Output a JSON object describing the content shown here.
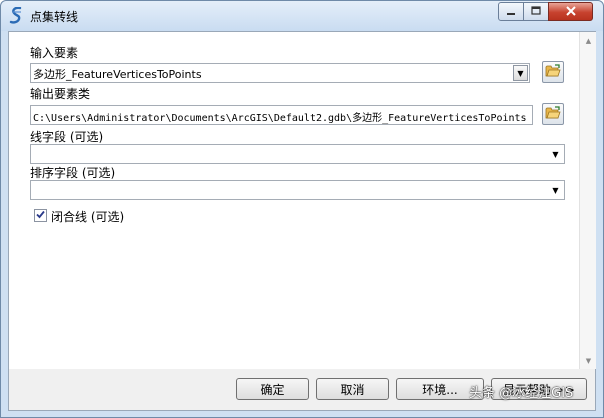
{
  "window": {
    "title": "点集转线"
  },
  "fields": {
    "input_features": {
      "label": "输入要素",
      "value": "多边形_FeatureVerticesToPoints"
    },
    "output_feature_class": {
      "label": "输出要素类",
      "value": "C:\\Users\\Administrator\\Documents\\ArcGIS\\Default2.gdb\\多边形_FeatureVerticesToPoints"
    },
    "line_field": {
      "label": "线字段 (可选)",
      "value": ""
    },
    "sort_field": {
      "label": "排序字段 (可选)",
      "value": ""
    },
    "close_line": {
      "label": "闭合线 (可选)",
      "checked": true
    }
  },
  "buttons": {
    "ok": "确定",
    "cancel": "取消",
    "environments": "环境...",
    "show_help": "显示帮助 >>"
  },
  "watermark": "头条 @冰经注GIS",
  "icons": {
    "app": "tool-icon",
    "browse": "folder-open-icon",
    "minimize": "minimize-icon",
    "maximize": "maximize-icon",
    "close": "close-icon"
  },
  "colors": {
    "titlebar": "#c9dcf1",
    "close_button": "#c7432f",
    "panel_background": "#f0f0f0",
    "form_background": "#ffffff"
  }
}
